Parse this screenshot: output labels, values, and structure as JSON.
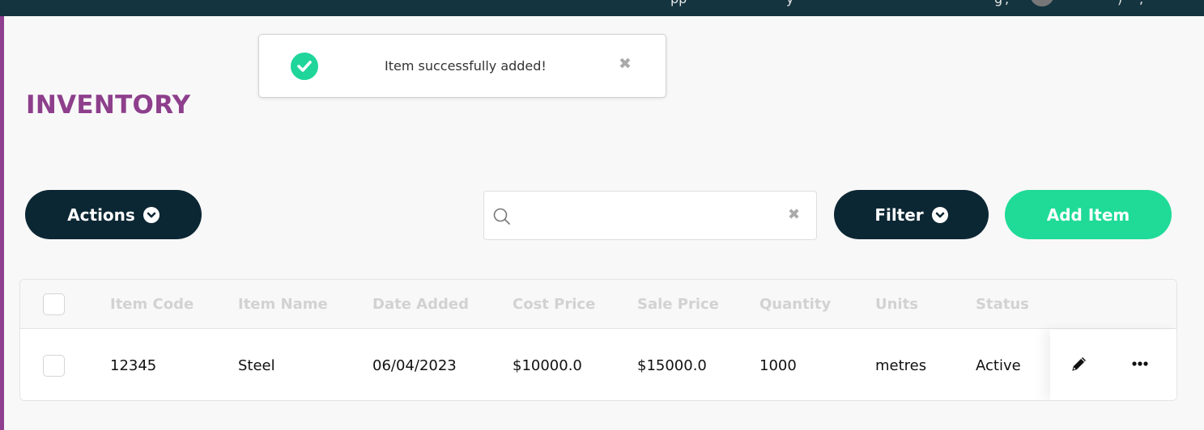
{
  "header": {
    "partial_texts": [
      "pp",
      "y",
      "g",
      ",",
      ")",
      ","
    ]
  },
  "page": {
    "title": "INVENTORY"
  },
  "toast": {
    "message": "Item successfully added!"
  },
  "toolbar": {
    "actions_label": "Actions",
    "filter_label": "Filter",
    "add_item_label": "Add Item",
    "search_value": "",
    "search_placeholder": ""
  },
  "table": {
    "columns": [
      "Item Code",
      "Item Name",
      "Date Added",
      "Cost Price",
      "Sale Price",
      "Quantity",
      "Units",
      "Status"
    ],
    "rows": [
      {
        "item_code": "12345",
        "item_name": "Steel",
        "date_added": "06/04/2023",
        "cost_price": "$10000.0",
        "sale_price": "$15000.0",
        "quantity": "1000",
        "units": "metres",
        "status": "Active"
      }
    ]
  },
  "colors": {
    "topbar": "#14343f",
    "accent": "#8d3f8c",
    "dark_button": "#0c2734",
    "green_button": "#1fdb97",
    "success": "#1fd59a"
  },
  "icons": [
    "check-circle-icon",
    "close-icon",
    "chevron-down-icon",
    "search-icon",
    "pencil-icon",
    "more-horizontal-icon"
  ]
}
